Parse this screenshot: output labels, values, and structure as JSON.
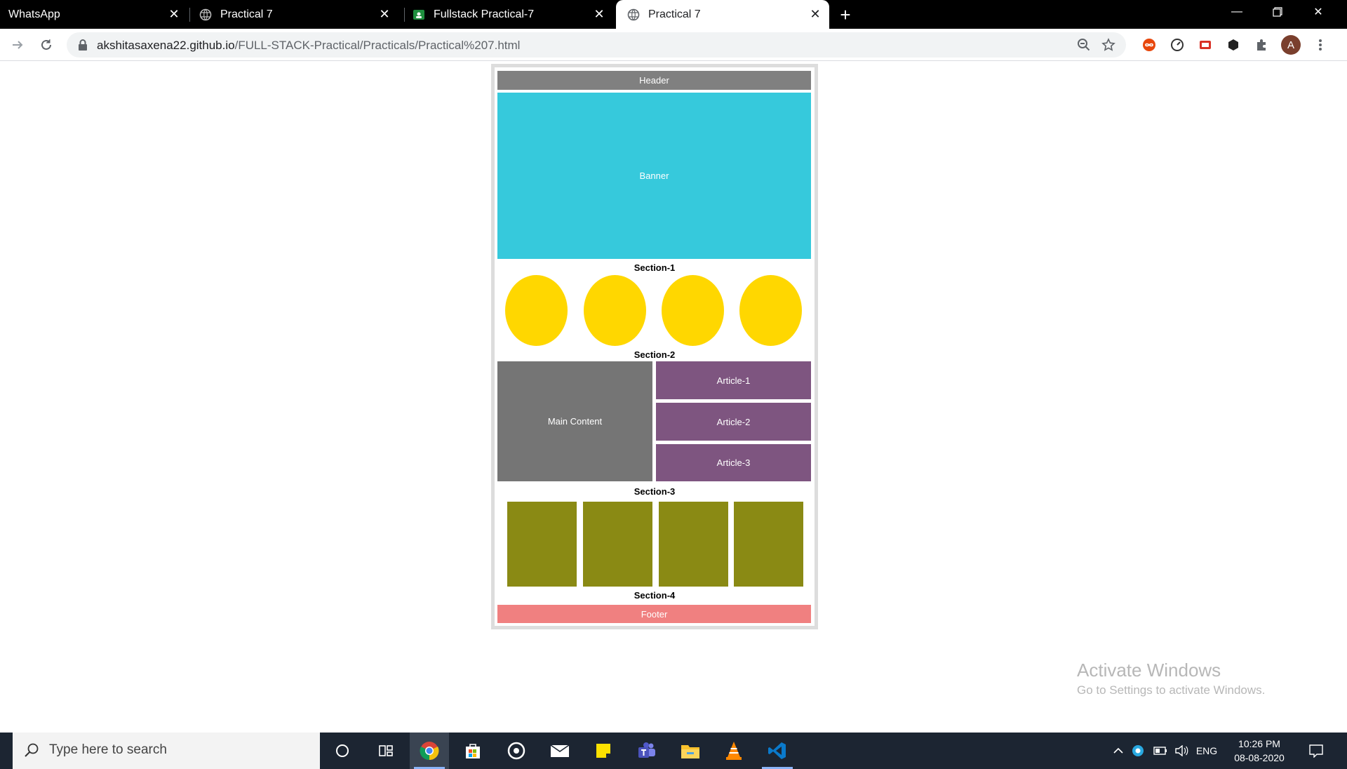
{
  "browser": {
    "tabs": [
      {
        "title": "WhatsApp",
        "icon": "whatsapp-icon",
        "active": false
      },
      {
        "title": "Practical 7",
        "icon": "globe-icon",
        "active": false
      },
      {
        "title": "Fullstack Practical-7",
        "icon": "google-classroom-icon",
        "active": false
      },
      {
        "title": "Practical 7",
        "icon": "globe-icon",
        "active": true
      }
    ],
    "address": {
      "host": "akshitasaxena22.github.io",
      "path": "/FULL-STACK-Practical/Practicals/Practical%207.html"
    },
    "avatar_letter": "A"
  },
  "page": {
    "header": "Header",
    "banner": "Banner",
    "section1_title": "Section-1",
    "section2_title": "Section-2",
    "main_content": "Main Content",
    "articles": [
      "Article-1",
      "Article-2",
      "Article-3"
    ],
    "section3_title": "Section-3",
    "section4_title": "Section-4",
    "footer": "Footer",
    "colors": {
      "header": "#808080",
      "banner": "#36c9dc",
      "circles": "#ffd700",
      "main_content": "#757575",
      "articles": "#7e5580",
      "olive_boxes": "#8a8a14",
      "footer": "#f08080"
    }
  },
  "watermark": {
    "title": "Activate Windows",
    "subtitle": "Go to Settings to activate Windows."
  },
  "taskbar": {
    "search_placeholder": "Type here to search",
    "language": "ENG",
    "time": "10:26 PM",
    "date": "08-08-2020"
  }
}
